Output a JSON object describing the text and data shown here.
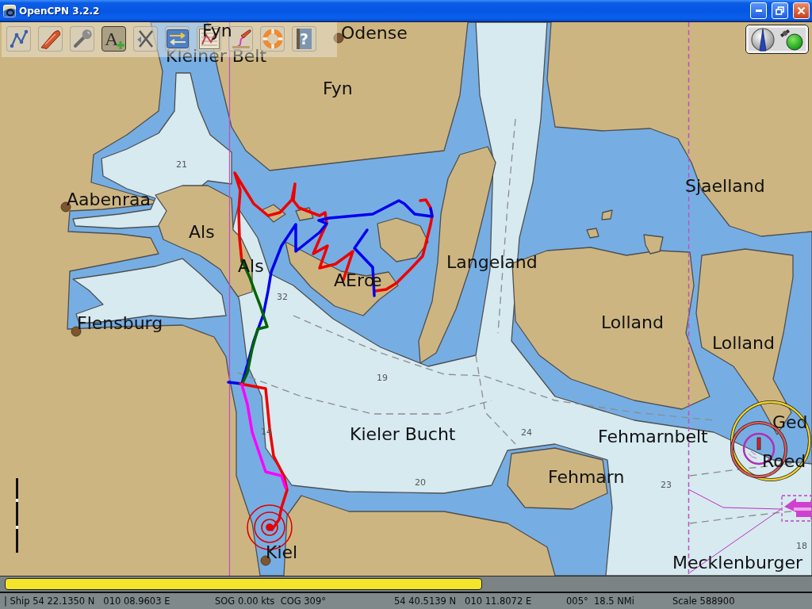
{
  "window": {
    "title": "OpenCPN 3.2.2"
  },
  "toolbar": [
    {
      "kind": "route",
      "toggled": false
    },
    {
      "kind": "own_ship",
      "toggled": false
    },
    {
      "kind": "settings",
      "toggled": false
    },
    {
      "kind": "text",
      "glyph": "A",
      "toggled": true
    },
    {
      "kind": "ais",
      "toggled": false
    },
    {
      "kind": "chart",
      "toggled": false
    },
    {
      "kind": "route_manager",
      "toggled": false
    },
    {
      "kind": "track",
      "toggled": false
    },
    {
      "kind": "mob",
      "toggled": false
    },
    {
      "kind": "help",
      "glyph": "?",
      "toggled": false
    }
  ],
  "compass": {
    "gps_fix": true
  },
  "chart": {
    "place_names": [
      "Fyn",
      "Odense",
      "Kleiner Belt",
      "Fyn",
      "Sjaelland",
      "Aabenraa",
      "Als",
      "Langeland",
      "Als",
      "AErœ",
      "Lolland",
      "Flensburg",
      "Lolland",
      "Ged",
      "Kieler Bucht",
      "Fehmarnbelt",
      "Roed",
      "Fehmarn",
      "Kiel",
      "Mecklenburger"
    ],
    "soundings": [
      "21",
      "32",
      "19",
      "14",
      "24",
      "20",
      "23",
      "18"
    ]
  },
  "tracks": [
    {
      "color": "#ee0000"
    },
    {
      "color": "#ee0000"
    },
    {
      "color": "#0000ee"
    },
    {
      "color": "#0000ee"
    },
    {
      "color": "#006400"
    },
    {
      "color": "#ee0000"
    },
    {
      "color": "#ff00ff"
    }
  ],
  "chart_bar": {
    "keys": [
      {
        "color": "#f4e42c"
      }
    ]
  },
  "status_bar": {
    "ship": "| Ship 54 22.1350 N   010 08.9603 E",
    "sog_cog": "SOG 0.00 kts  COG 309°",
    "cursor": "54 40.5139 N   010 11.8072 E",
    "bearing_distance": "005°  18.5 NMi",
    "scale": "Scale 588900"
  }
}
